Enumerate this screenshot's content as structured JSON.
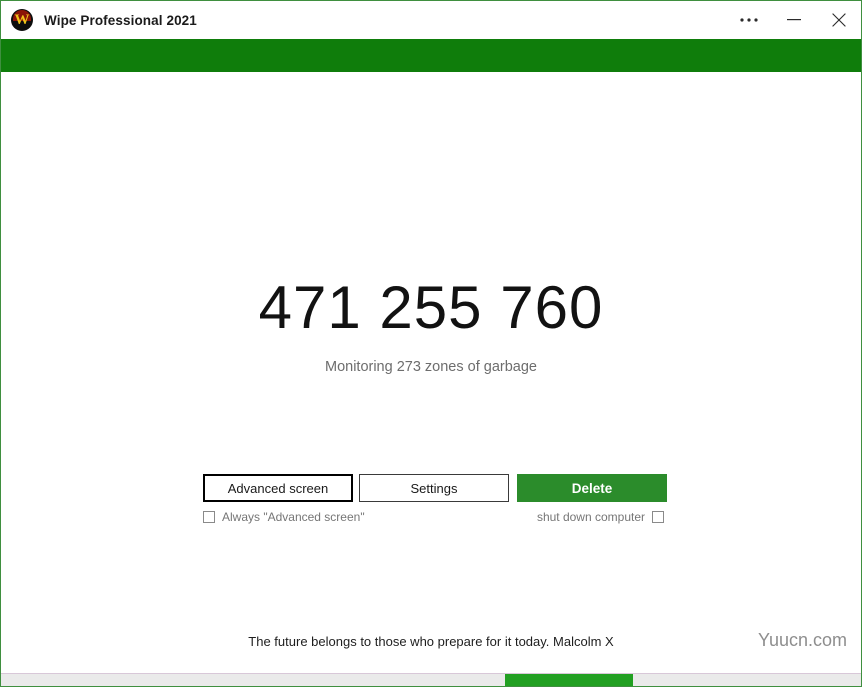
{
  "window": {
    "title": "Wipe Professional 2021",
    "app_icon_name": "wipe-logo-icon",
    "app_icon_letter": "W",
    "border_color": "#3f8f3f",
    "controls": [
      {
        "name": "more-options-icon",
        "glyph": "•••",
        "label": "More"
      },
      {
        "name": "minimize-icon",
        "glyph": "—",
        "label": "Minimize"
      },
      {
        "name": "close-icon",
        "glyph": "✕",
        "label": "Close"
      }
    ]
  },
  "header": {
    "band_color": "#0f7d0b"
  },
  "main": {
    "counter": "471 255 760",
    "status": "Monitoring 273 zones of garbage",
    "buttons": [
      {
        "name": "advanced-screen-button",
        "label": "Advanced screen",
        "style": "focused"
      },
      {
        "name": "settings-button",
        "label": "Settings",
        "style": "default"
      },
      {
        "name": "delete-button",
        "label": "Delete",
        "style": "primary"
      }
    ],
    "options": [
      {
        "name": "always-advanced-screen-checkbox",
        "label": "Always \"Advanced screen\"",
        "checked": false,
        "label_position": "right"
      },
      {
        "name": "shut-down-computer-checkbox",
        "label": "shut down computer",
        "checked": false,
        "label_position": "left"
      }
    ],
    "primary_color": "#2b8c2b"
  },
  "footer": {
    "quote": "The future belongs to those who prepare for it today. Malcolm X",
    "watermark": "Yuucn.com"
  },
  "status_bar": {
    "progress_color": "#22a022",
    "track_color": "#eaeaea"
  }
}
